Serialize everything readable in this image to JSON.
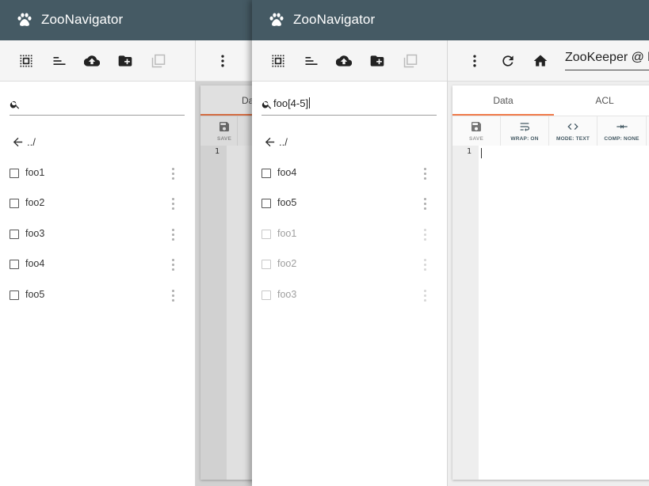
{
  "app": {
    "title": "ZooNavigator"
  },
  "back_window": {
    "search": {
      "value": ""
    },
    "parent_label": "../",
    "nodes": [
      {
        "label": "foo1"
      },
      {
        "label": "foo2"
      },
      {
        "label": "foo3"
      },
      {
        "label": "foo4"
      },
      {
        "label": "foo5"
      }
    ],
    "editor": {
      "tab_data_partial": "Da",
      "save_label": "SAVE",
      "line_number": "1"
    }
  },
  "front_window": {
    "search": {
      "value": "foo[4-5]"
    },
    "parent_label": "../",
    "nodes": [
      {
        "label": "foo4",
        "dimmed": false
      },
      {
        "label": "foo5",
        "dimmed": false
      },
      {
        "label": "foo1",
        "dimmed": true
      },
      {
        "label": "foo2",
        "dimmed": true
      },
      {
        "label": "foo3",
        "dimmed": true
      }
    ],
    "connection_path": "ZooKeeper @ lo",
    "tabs": [
      {
        "label": "Data"
      },
      {
        "label": "ACL"
      }
    ],
    "editor_toolbar": {
      "save_label": "SAVE",
      "wrap_label": "WRAP: ON",
      "mode_label": "MODE: TEXT",
      "comp_label": "COMP: NONE"
    },
    "line_number": "1"
  },
  "colors": {
    "appbar": "#455a64",
    "accent": "#f07a4a"
  },
  "icons": [
    "paw-icon",
    "select-all-icon",
    "sort-icon",
    "upload-icon",
    "new-folder-icon",
    "copy-icon",
    "more-vert-icon",
    "refresh-icon",
    "home-icon",
    "search-icon",
    "arrow-back-icon",
    "save-icon",
    "wrap-icon",
    "code-icon",
    "compress-icon"
  ]
}
